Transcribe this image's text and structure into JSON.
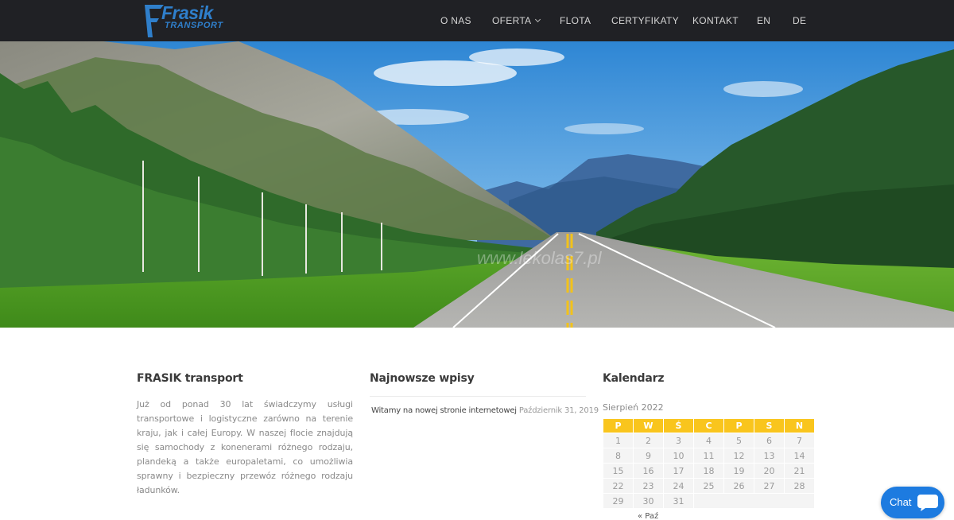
{
  "brand": {
    "name": "Frasik",
    "sub": "TRANSPORT",
    "color": "#2f7fcb"
  },
  "nav": {
    "items": [
      {
        "label": "O NAS",
        "has_dropdown": false
      },
      {
        "label": "OFERTA",
        "has_dropdown": true
      },
      {
        "label": "FLOTA",
        "has_dropdown": false
      },
      {
        "label": "CERTYFIKATY",
        "has_dropdown": false
      },
      {
        "label": "KONTAKT",
        "has_dropdown": false
      },
      {
        "label": "EN",
        "has_dropdown": false
      },
      {
        "label": "DE",
        "has_dropdown": false
      }
    ]
  },
  "hero": {
    "watermark": "www.lekolas7.pl"
  },
  "about": {
    "title": "FRASIK transport",
    "text": "Już od ponad 30 lat świadczymy usługi transportowe i logistyczne zarówno na terenie kraju, jak i całej Europy. W naszej flocie znajdują się samochody z konenerami różnego rodzaju, plandeką a także europaletami, co umożliwia sprawny i bezpieczny przewóz różnego rodzaju ładunków."
  },
  "posts": {
    "title": "Najnowsze wpisy",
    "items": [
      {
        "link": "Witamy na nowej stronie internetowej",
        "date": "Październik 31, 2019"
      }
    ]
  },
  "calendar": {
    "title": "Kalendarz",
    "caption": "Sierpień 2022",
    "days": [
      "P",
      "W",
      "Ś",
      "C",
      "P",
      "S",
      "N"
    ],
    "weeks": [
      [
        "1",
        "2",
        "3",
        "4",
        "5",
        "6",
        "7"
      ],
      [
        "8",
        "9",
        "10",
        "11",
        "12",
        "13",
        "14"
      ],
      [
        "15",
        "16",
        "17",
        "18",
        "19",
        "20",
        "21"
      ],
      [
        "22",
        "23",
        "24",
        "25",
        "26",
        "27",
        "28"
      ],
      [
        "29",
        "30",
        "31",
        "",
        "",
        "",
        ""
      ]
    ],
    "prev_link": "« Paź",
    "header_color": "#f9c51d"
  },
  "chat": {
    "label": "Chat",
    "color": "#1d7be0"
  },
  "colors": {
    "header_bg": "#202125",
    "accent": "#f9c51d"
  }
}
